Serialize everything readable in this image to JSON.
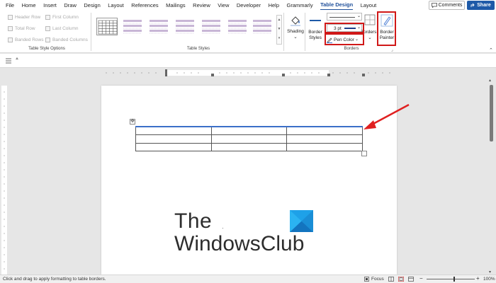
{
  "menu": {
    "tabs": [
      "File",
      "Home",
      "Insert",
      "Draw",
      "Design",
      "Layout",
      "References",
      "Mailings",
      "Review",
      "View",
      "Developer",
      "Help",
      "Grammarly",
      "Table Design",
      "Layout"
    ],
    "active_tab": "Table Design",
    "comments_label": "Comments",
    "share_label": "Share"
  },
  "ribbon": {
    "style_options": {
      "items": [
        "Header Row",
        "First Column",
        "Total Row",
        "Last Column",
        "Banded Rows",
        "Banded Columns"
      ],
      "group_label": "Table Style Options"
    },
    "table_styles": {
      "group_label": "Table Styles"
    },
    "shading": {
      "label": "Shading"
    },
    "borders": {
      "border_styles_label_1": "Border",
      "border_styles_label_2": "Styles",
      "weight_value": "3 pt",
      "pen_color_label": "Pen Color",
      "borders_label": "Borders",
      "group_label": "Borders",
      "border_painter_label_1": "Border",
      "border_painter_label_2": "Painter"
    }
  },
  "status": {
    "text": "Click and drag to apply formatting to table borders.",
    "focus_label": "Focus",
    "zoom": "100%"
  },
  "logo": {
    "line1": "The",
    "line2": "WindowsClub"
  },
  "colors": {
    "accent": "#1e5aa8",
    "highlight": "#d01818",
    "table_top_border": "#3b6fc8"
  }
}
